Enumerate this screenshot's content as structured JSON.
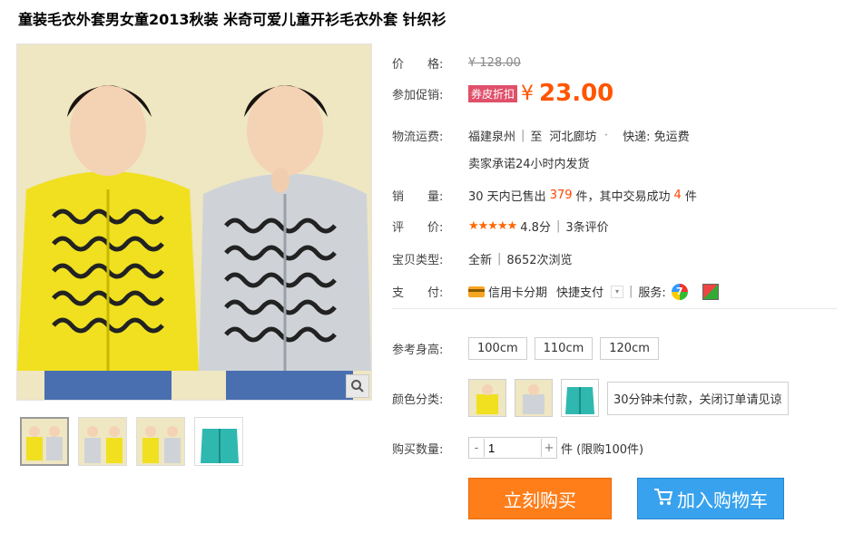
{
  "title": "童装毛衣外套男女童2013秋装 米奇可爱儿童开衫毛衣外套 针织衫",
  "price": {
    "label": "价　　格:",
    "original": "¥ 128.00"
  },
  "promo": {
    "label": "参加促销:",
    "badge": "券皮折扣",
    "currency": "¥",
    "value": "23.00"
  },
  "shipping": {
    "label": "物流运费:",
    "from": "福建泉州",
    "to_word": "至",
    "to": "河北廊坊",
    "express": "快递: 免运费",
    "promise": "卖家承诺24小时内发货"
  },
  "sales": {
    "label": "销　　量:",
    "prefix": "30 天内已售出",
    "count": "379",
    "mid": "件，其中交易成功",
    "success": "4",
    "suffix": "件"
  },
  "rating": {
    "label": "评　　价:",
    "stars": "★★★★★",
    "score": "4.8分",
    "reviews": "3条评价"
  },
  "type": {
    "label": "宝贝类型:",
    "condition": "全新",
    "views": "8652次浏览"
  },
  "payment": {
    "label": "支　　付:",
    "card": "信用卡分期",
    "quick": "快捷支付",
    "service_label": "服务:"
  },
  "sizes": {
    "label": "参考身高:",
    "options": [
      "100cm",
      "110cm",
      "120cm"
    ]
  },
  "colors": {
    "label": "颜色分类:",
    "tip": "30分钟未付款，关闭订单请见谅"
  },
  "quantity": {
    "label": "购买数量:",
    "value": "1",
    "minus": "-",
    "plus": "+",
    "limit": "件 (限购100件)"
  },
  "buttons": {
    "buy": "立刻购买",
    "cart": "加入购物车"
  },
  "colors_theme": {
    "price": "#ff5500",
    "buy": "#ff7e1a",
    "cart": "#38a2ee"
  }
}
